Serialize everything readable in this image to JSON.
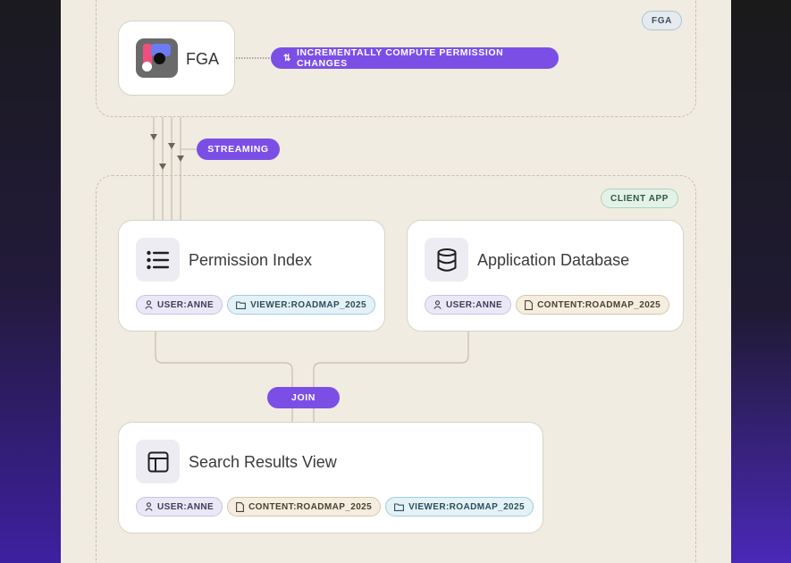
{
  "tags": {
    "fga": "FGA",
    "client_app": "CLIENT APP"
  },
  "pills": {
    "compute": "INCREMENTALLY COMPUTE PERMISSION CHANGES",
    "compute_icon": "arrows-up-down-icon",
    "streaming": "STREAMING",
    "join": "JOIN"
  },
  "fga_card": {
    "label": "FGA",
    "icon": "fga-logo"
  },
  "permission_index": {
    "title": "Permission Index",
    "icon": "list-icon",
    "chips": [
      {
        "label": "USER:ANNE",
        "icon": "user-icon"
      },
      {
        "label": "VIEWER:ROADMAP_2025",
        "icon": "folder-icon"
      }
    ]
  },
  "application_database": {
    "title": "Application Database",
    "icon": "database-icon",
    "chips": [
      {
        "label": "USER:ANNE",
        "icon": "user-icon"
      },
      {
        "label": "CONTENT:ROADMAP_2025",
        "icon": "file-icon"
      }
    ]
  },
  "search_results_view": {
    "title": "Search Results View",
    "icon": "table-icon",
    "chips": [
      {
        "label": "USER:ANNE",
        "icon": "user-icon"
      },
      {
        "label": "CONTENT:ROADMAP_2025",
        "icon": "file-icon"
      },
      {
        "label": "VIEWER:ROADMAP_2025",
        "icon": "folder-icon"
      }
    ]
  },
  "colors": {
    "canvas": "#f1ece1",
    "accent_purple": "#7b4fe6",
    "connector": "#b9b1a2",
    "arrow": "#6b6458"
  }
}
